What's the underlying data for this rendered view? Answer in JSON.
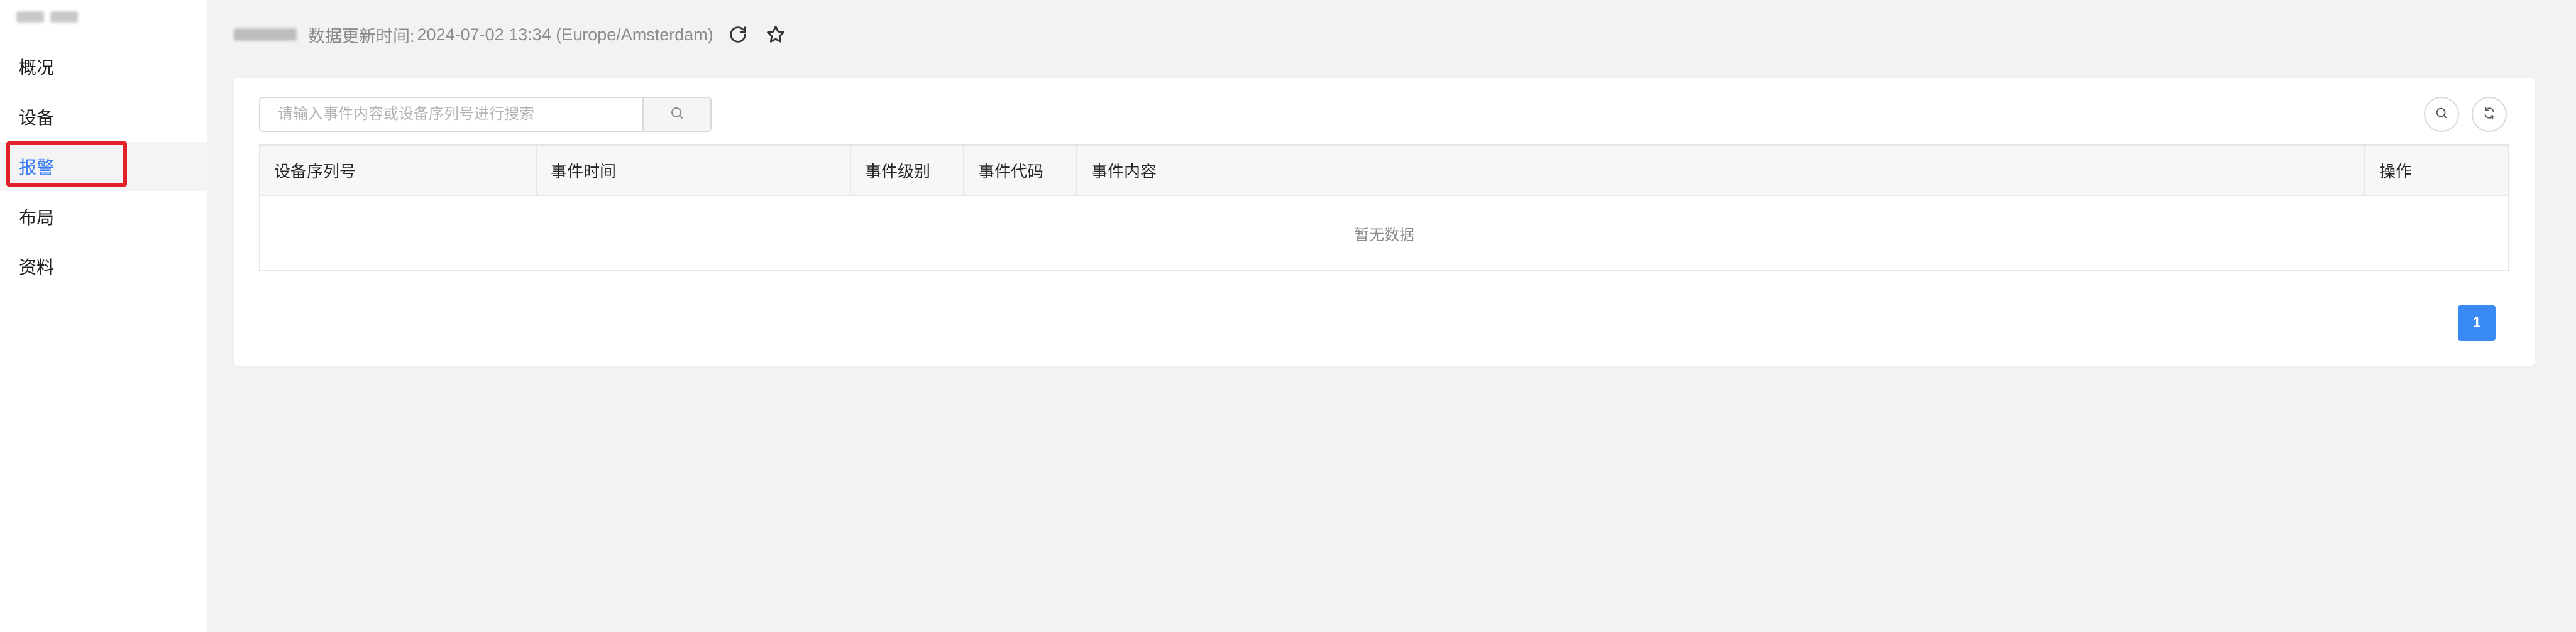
{
  "sidebar": {
    "items": [
      {
        "label": "概况"
      },
      {
        "label": "设备"
      },
      {
        "label": "报警"
      },
      {
        "label": "布局"
      },
      {
        "label": "资料"
      }
    ],
    "active_index": 2
  },
  "header": {
    "update_label": "数据更新时间:",
    "update_time": "2024-07-02 13:34 (Europe/Amsterdam)"
  },
  "search": {
    "placeholder": "请输入事件内容或设备序列号进行搜索"
  },
  "table": {
    "columns": [
      "设备序列号",
      "事件时间",
      "事件级别",
      "事件代码",
      "事件内容",
      "操作"
    ],
    "empty_text": "暂无数据"
  },
  "pagination": {
    "current_page": "1"
  },
  "colors": {
    "accent": "#3a8af6",
    "highlight": "#e0212a",
    "active_nav_text": "#3a7bf6"
  }
}
